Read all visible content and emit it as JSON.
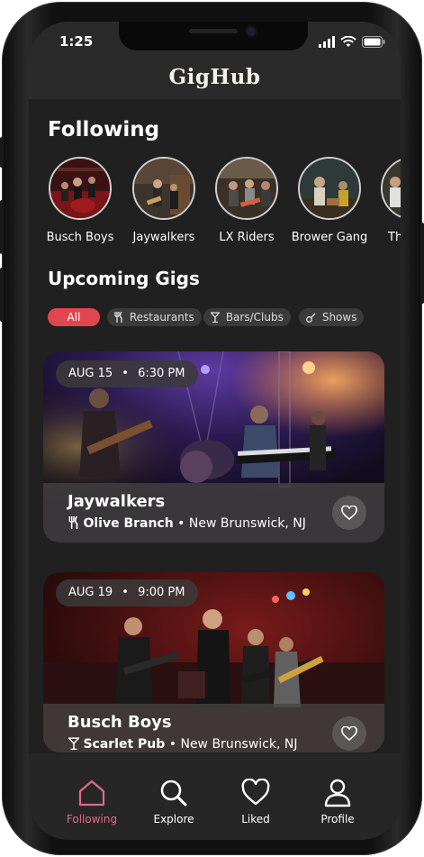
{
  "status": {
    "time": "1:25"
  },
  "app": {
    "title": "GigHub"
  },
  "following": {
    "heading": "Following",
    "artists": [
      {
        "name": "Busch Boys"
      },
      {
        "name": "Jaywalkers"
      },
      {
        "name": "LX Riders"
      },
      {
        "name": "Brower Gang"
      },
      {
        "name": "Th"
      }
    ]
  },
  "upcoming": {
    "heading": "Upcoming Gigs",
    "filters": [
      {
        "label": "All",
        "icon": "none",
        "active": true
      },
      {
        "label": "Restaurants",
        "icon": "fork-knife-icon"
      },
      {
        "label": "Bars/Clubs",
        "icon": "cocktail-glass-icon"
      },
      {
        "label": "Shows",
        "icon": "guitar-icon"
      }
    ]
  },
  "gigs": [
    {
      "date": "AUG 15",
      "time": "6:30 PM",
      "artist": "Jaywalkers",
      "venue": "Olive Branch",
      "location": "New Brunswick, NJ",
      "venue_icon": "fork-knife-icon"
    },
    {
      "date": "AUG 19",
      "time": "9:00 PM",
      "artist": "Busch Boys",
      "venue": "Scarlet Pub",
      "location": "New Brunswick, NJ",
      "venue_icon": "cocktail-glass-icon"
    }
  ],
  "separator": "•",
  "tabs": [
    {
      "label": "Following",
      "icon": "home-icon",
      "active": true
    },
    {
      "label": "Explore",
      "icon": "search-icon"
    },
    {
      "label": "Liked",
      "icon": "heart-icon"
    },
    {
      "label": "Profile",
      "icon": "user-icon"
    }
  ],
  "colors": {
    "accent": "#e0464e",
    "active_tab": "#e06a8a",
    "background": "#202020"
  }
}
